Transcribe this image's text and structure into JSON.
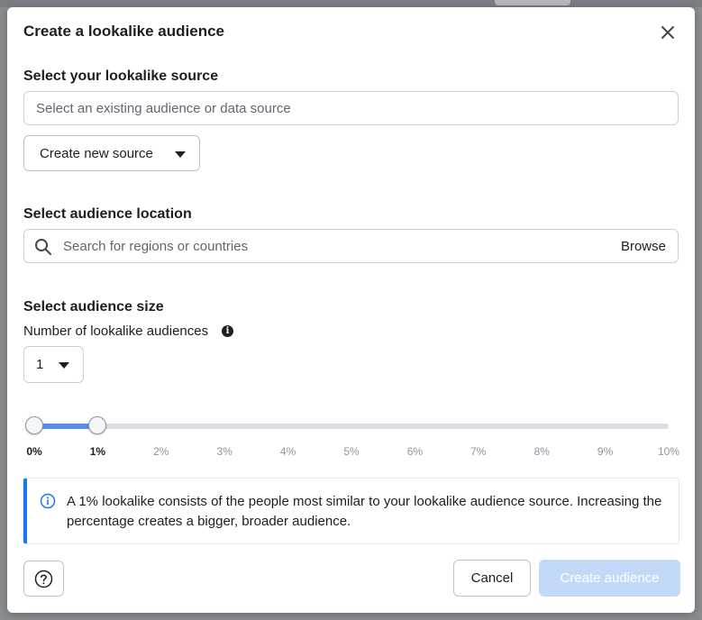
{
  "dialog": {
    "title": "Create a lookalike audience",
    "close_icon": "close-icon"
  },
  "source": {
    "label": "Select your lookalike source",
    "placeholder": "Select an existing audience or data source",
    "create_new_label": "Create new source"
  },
  "location": {
    "label": "Select audience location",
    "placeholder": "Search for regions or countries",
    "browse_label": "Browse"
  },
  "size": {
    "label": "Select audience size",
    "count_label": "Number of lookalike audiences",
    "count_value": "1",
    "slider": {
      "start": "0%",
      "end": "1%",
      "ticks": [
        "0%",
        "1%",
        "2%",
        "3%",
        "4%",
        "5%",
        "6%",
        "7%",
        "8%",
        "9%",
        "10%"
      ],
      "range_start_value": 0,
      "range_end_value": 1,
      "max_value": 10
    }
  },
  "notice": {
    "text": "A 1% lookalike consists of the people most similar to your lookalike audience source. Increasing the percentage creates a bigger, broader audience."
  },
  "footer": {
    "help_icon": "help-icon",
    "cancel_label": "Cancel",
    "create_label": "Create audience"
  },
  "colors": {
    "accent": "#1877f2",
    "slider_fill": "#5c8de6",
    "disabled_button": "#c2daf7"
  }
}
